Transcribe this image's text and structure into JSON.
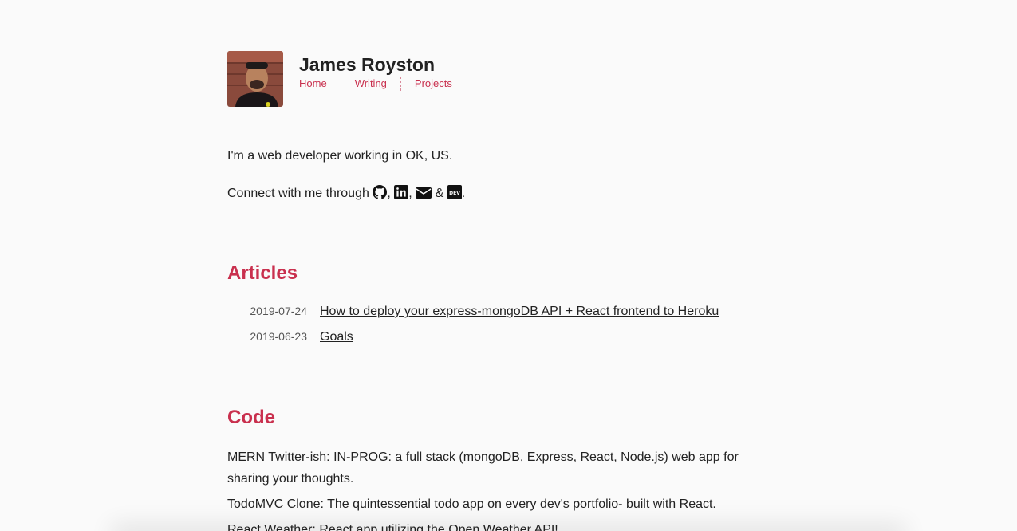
{
  "header": {
    "name": "James Royston",
    "nav": [
      "Home",
      "Writing",
      "Projects"
    ]
  },
  "intro": {
    "bio": "I'm a web developer working in OK, US.",
    "connect_prefix": "Connect with me through",
    "sep1": ",",
    "sep2": ",",
    "amp": "&",
    "end": ".",
    "icons": [
      "github-icon",
      "linkedin-icon",
      "email-icon",
      "dev-icon"
    ]
  },
  "articles": {
    "title": "Articles",
    "items": [
      {
        "date": "2019-07-24",
        "title": "How to deploy your express-mongoDB API + React frontend to Heroku"
      },
      {
        "date": "2019-06-23",
        "title": "Goals"
      }
    ]
  },
  "code": {
    "title": "Code",
    "items": [
      {
        "name": "MERN Twitter-ish",
        "desc": ": IN-PROG: a full stack (mongoDB, Express, React, Node.js) web app for sharing your thoughts."
      },
      {
        "name": "TodoMVC Clone",
        "desc": ": The quintessential todo app on every dev's portfolio- built with React."
      },
      {
        "name": "React Weather",
        "desc": ": React app utilizing the Open Weather API!"
      }
    ]
  },
  "colors": {
    "accent": "#c9304e",
    "text": "#222222",
    "background": "#fafafa"
  }
}
